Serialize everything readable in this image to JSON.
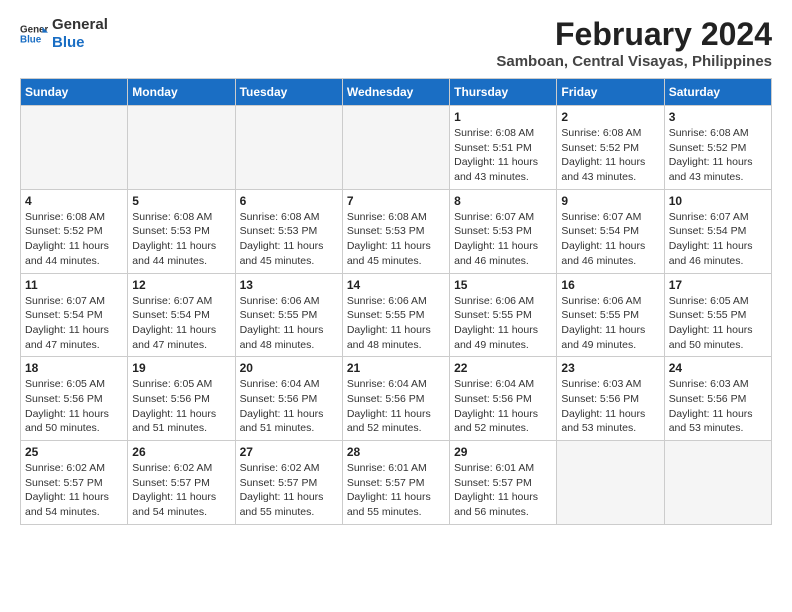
{
  "header": {
    "logo_line1": "General",
    "logo_line2": "Blue",
    "title": "February 2024",
    "subtitle": "Samboan, Central Visayas, Philippines"
  },
  "calendar": {
    "days_of_week": [
      "Sunday",
      "Monday",
      "Tuesday",
      "Wednesday",
      "Thursday",
      "Friday",
      "Saturday"
    ],
    "weeks": [
      [
        {
          "day": "",
          "info": "",
          "empty": true
        },
        {
          "day": "",
          "info": "",
          "empty": true
        },
        {
          "day": "",
          "info": "",
          "empty": true
        },
        {
          "day": "",
          "info": "",
          "empty": true
        },
        {
          "day": "1",
          "info": "Sunrise: 6:08 AM\nSunset: 5:51 PM\nDaylight: 11 hours\nand 43 minutes."
        },
        {
          "day": "2",
          "info": "Sunrise: 6:08 AM\nSunset: 5:52 PM\nDaylight: 11 hours\nand 43 minutes."
        },
        {
          "day": "3",
          "info": "Sunrise: 6:08 AM\nSunset: 5:52 PM\nDaylight: 11 hours\nand 43 minutes."
        }
      ],
      [
        {
          "day": "4",
          "info": "Sunrise: 6:08 AM\nSunset: 5:52 PM\nDaylight: 11 hours\nand 44 minutes."
        },
        {
          "day": "5",
          "info": "Sunrise: 6:08 AM\nSunset: 5:53 PM\nDaylight: 11 hours\nand 44 minutes."
        },
        {
          "day": "6",
          "info": "Sunrise: 6:08 AM\nSunset: 5:53 PM\nDaylight: 11 hours\nand 45 minutes."
        },
        {
          "day": "7",
          "info": "Sunrise: 6:08 AM\nSunset: 5:53 PM\nDaylight: 11 hours\nand 45 minutes."
        },
        {
          "day": "8",
          "info": "Sunrise: 6:07 AM\nSunset: 5:53 PM\nDaylight: 11 hours\nand 46 minutes."
        },
        {
          "day": "9",
          "info": "Sunrise: 6:07 AM\nSunset: 5:54 PM\nDaylight: 11 hours\nand 46 minutes."
        },
        {
          "day": "10",
          "info": "Sunrise: 6:07 AM\nSunset: 5:54 PM\nDaylight: 11 hours\nand 46 minutes."
        }
      ],
      [
        {
          "day": "11",
          "info": "Sunrise: 6:07 AM\nSunset: 5:54 PM\nDaylight: 11 hours\nand 47 minutes."
        },
        {
          "day": "12",
          "info": "Sunrise: 6:07 AM\nSunset: 5:54 PM\nDaylight: 11 hours\nand 47 minutes."
        },
        {
          "day": "13",
          "info": "Sunrise: 6:06 AM\nSunset: 5:55 PM\nDaylight: 11 hours\nand 48 minutes."
        },
        {
          "day": "14",
          "info": "Sunrise: 6:06 AM\nSunset: 5:55 PM\nDaylight: 11 hours\nand 48 minutes."
        },
        {
          "day": "15",
          "info": "Sunrise: 6:06 AM\nSunset: 5:55 PM\nDaylight: 11 hours\nand 49 minutes."
        },
        {
          "day": "16",
          "info": "Sunrise: 6:06 AM\nSunset: 5:55 PM\nDaylight: 11 hours\nand 49 minutes."
        },
        {
          "day": "17",
          "info": "Sunrise: 6:05 AM\nSunset: 5:55 PM\nDaylight: 11 hours\nand 50 minutes."
        }
      ],
      [
        {
          "day": "18",
          "info": "Sunrise: 6:05 AM\nSunset: 5:56 PM\nDaylight: 11 hours\nand 50 minutes."
        },
        {
          "day": "19",
          "info": "Sunrise: 6:05 AM\nSunset: 5:56 PM\nDaylight: 11 hours\nand 51 minutes."
        },
        {
          "day": "20",
          "info": "Sunrise: 6:04 AM\nSunset: 5:56 PM\nDaylight: 11 hours\nand 51 minutes."
        },
        {
          "day": "21",
          "info": "Sunrise: 6:04 AM\nSunset: 5:56 PM\nDaylight: 11 hours\nand 52 minutes."
        },
        {
          "day": "22",
          "info": "Sunrise: 6:04 AM\nSunset: 5:56 PM\nDaylight: 11 hours\nand 52 minutes."
        },
        {
          "day": "23",
          "info": "Sunrise: 6:03 AM\nSunset: 5:56 PM\nDaylight: 11 hours\nand 53 minutes."
        },
        {
          "day": "24",
          "info": "Sunrise: 6:03 AM\nSunset: 5:56 PM\nDaylight: 11 hours\nand 53 minutes."
        }
      ],
      [
        {
          "day": "25",
          "info": "Sunrise: 6:02 AM\nSunset: 5:57 PM\nDaylight: 11 hours\nand 54 minutes."
        },
        {
          "day": "26",
          "info": "Sunrise: 6:02 AM\nSunset: 5:57 PM\nDaylight: 11 hours\nand 54 minutes."
        },
        {
          "day": "27",
          "info": "Sunrise: 6:02 AM\nSunset: 5:57 PM\nDaylight: 11 hours\nand 55 minutes."
        },
        {
          "day": "28",
          "info": "Sunrise: 6:01 AM\nSunset: 5:57 PM\nDaylight: 11 hours\nand 55 minutes."
        },
        {
          "day": "29",
          "info": "Sunrise: 6:01 AM\nSunset: 5:57 PM\nDaylight: 11 hours\nand 56 minutes."
        },
        {
          "day": "",
          "info": "",
          "empty": true
        },
        {
          "day": "",
          "info": "",
          "empty": true
        }
      ]
    ]
  }
}
